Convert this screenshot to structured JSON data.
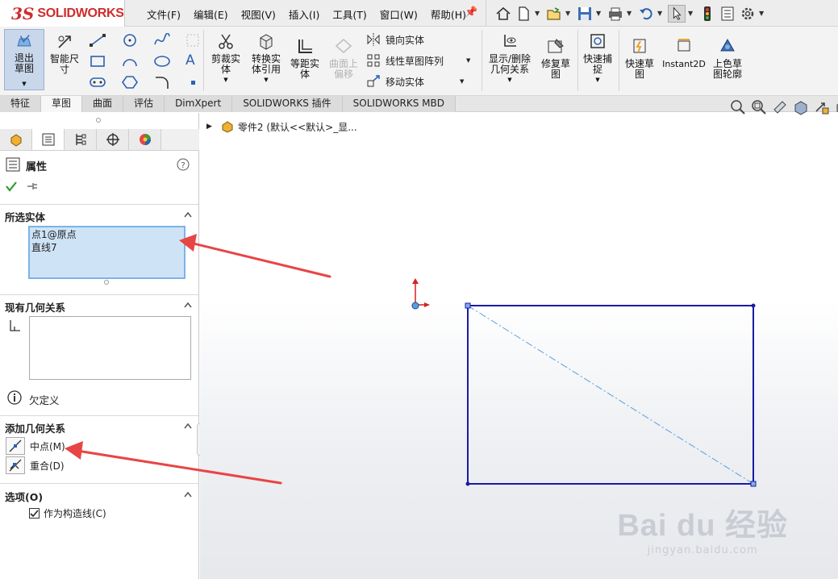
{
  "app": {
    "brand": "SOLIDWORKS",
    "brand_color": "#d12b2b"
  },
  "menus": [
    "文件(F)",
    "编辑(E)",
    "视图(V)",
    "插入(I)",
    "工具(T)",
    "窗口(W)",
    "帮助(H)"
  ],
  "quick_access_icons": [
    "home-icon",
    "new-icon",
    "open-icon",
    "save-icon",
    "print-icon",
    "undo-icon",
    "select-icon",
    "traffic-light-icon",
    "file-properties-icon",
    "options-icon"
  ],
  "ribbon": {
    "exit_sketch": "退出草图",
    "smart_dimension": "智能尺寸",
    "trim": "剪裁实体",
    "convert": "转换实体引用",
    "offset": "等距实体",
    "surface_offset": "曲面上偏移",
    "mirror": "镜向实体",
    "linear_pattern": "线性草图阵列",
    "move": "移动实体",
    "display_relations": "显示/删除几何关系",
    "repair": "修复草图",
    "quick_snap": "快速捕捉",
    "rapid_sketch": "快速草图",
    "instant2d": "Instant2D",
    "shaded_contours": "上色草图轮廓"
  },
  "tabs": [
    "特征",
    "草图",
    "曲面",
    "评估",
    "DimXpert",
    "SOLIDWORKS 插件",
    "SOLIDWORKS MBD"
  ],
  "active_tab": "草图",
  "panel": {
    "title": "属性",
    "selected_entities": {
      "title": "所选实体",
      "items": [
        "点1@原点",
        "直线7"
      ]
    },
    "existing_relations": {
      "title": "现有几何关系",
      "status": "欠定义"
    },
    "add_relations": {
      "title": "添加几何关系",
      "items": [
        "中点(M)",
        "重合(D)"
      ]
    },
    "options": {
      "title": "选项(O)",
      "construction_label": "作为构造线(C)",
      "construction_checked": true
    }
  },
  "feature_tree": {
    "label": "零件2  (默认<<默认>_显..."
  },
  "watermark": {
    "brand": "Bai du 经验",
    "url": "jingyan.baidu.com"
  },
  "colors": {
    "sketch_line": "#1a1aa8",
    "construction_line": "#5aa0e0",
    "annotation_arrow": "#e84545",
    "selection_fill": "#cfe3f7"
  }
}
